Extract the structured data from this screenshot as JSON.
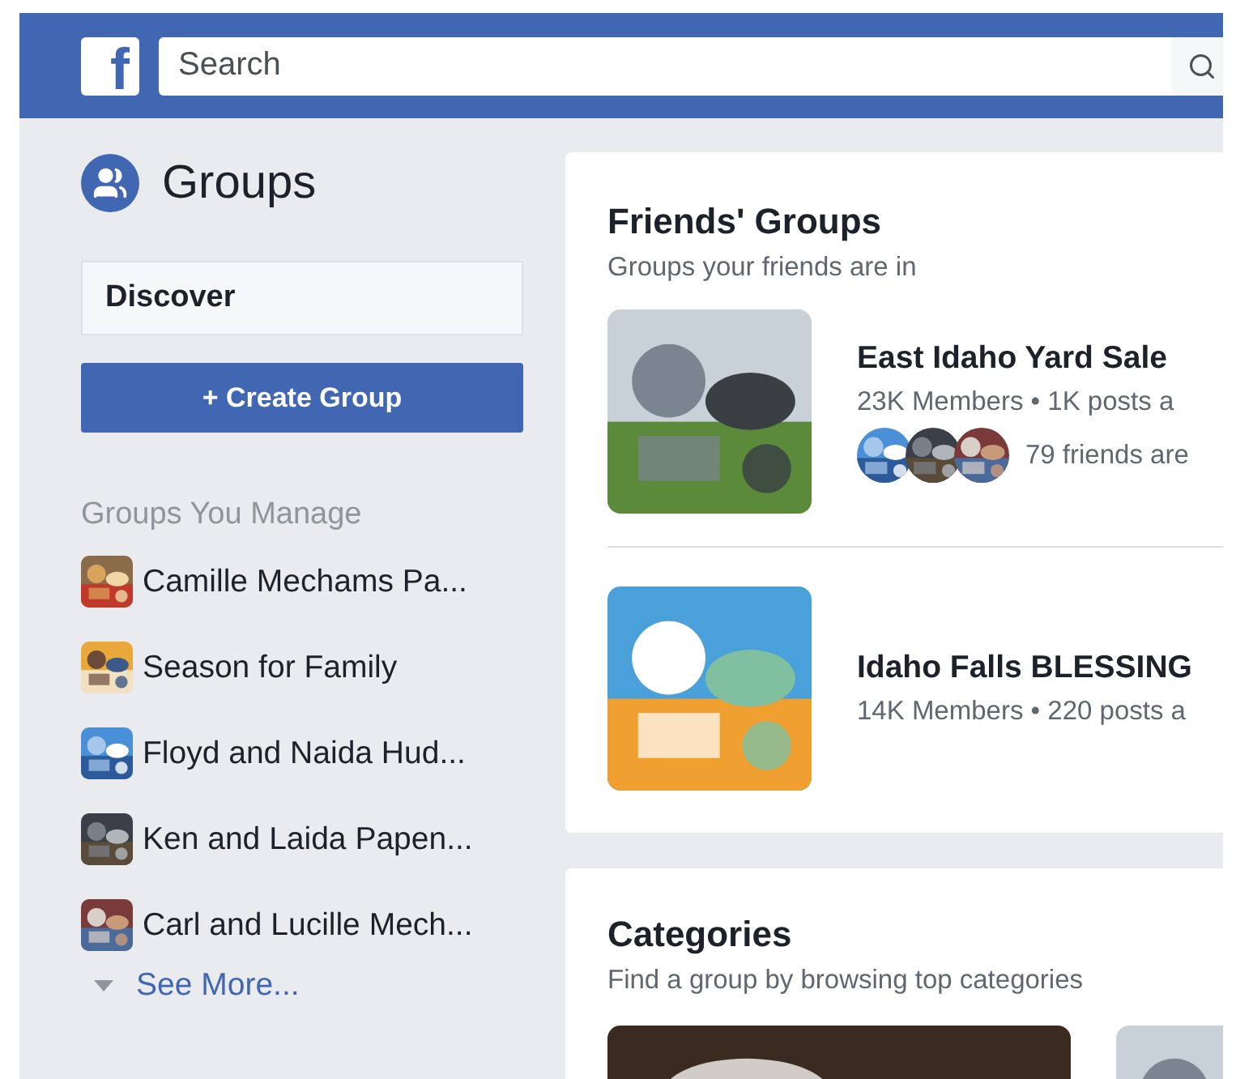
{
  "top_bar": {
    "logo": "f",
    "search": {
      "placeholder": "Search"
    }
  },
  "sidebar": {
    "title": "Groups",
    "discover": "Discover",
    "create_button": "+ Create Group",
    "section_title": "Groups You Manage",
    "groups": [
      {
        "name": "Camille Mechams Pa..."
      },
      {
        "name": "Season for Family"
      },
      {
        "name": "Floyd and Naida Hud..."
      },
      {
        "name": "Ken and Laida Papen..."
      },
      {
        "name": "Carl and Lucille Mech..."
      }
    ],
    "see_more": "See More..."
  },
  "friends_groups": {
    "title": "Friends' Groups",
    "subtitle": "Groups your friends are in",
    "groups": [
      {
        "name": "East Idaho Yard Sale",
        "meta": "23K Members • 1K posts a",
        "friends": "79 friends are"
      },
      {
        "name": "Idaho Falls BLESSING",
        "meta": "14K Members • 220 posts a"
      }
    ]
  },
  "categories": {
    "title": "Categories",
    "subtitle": "Find a group by browsing top categories"
  }
}
